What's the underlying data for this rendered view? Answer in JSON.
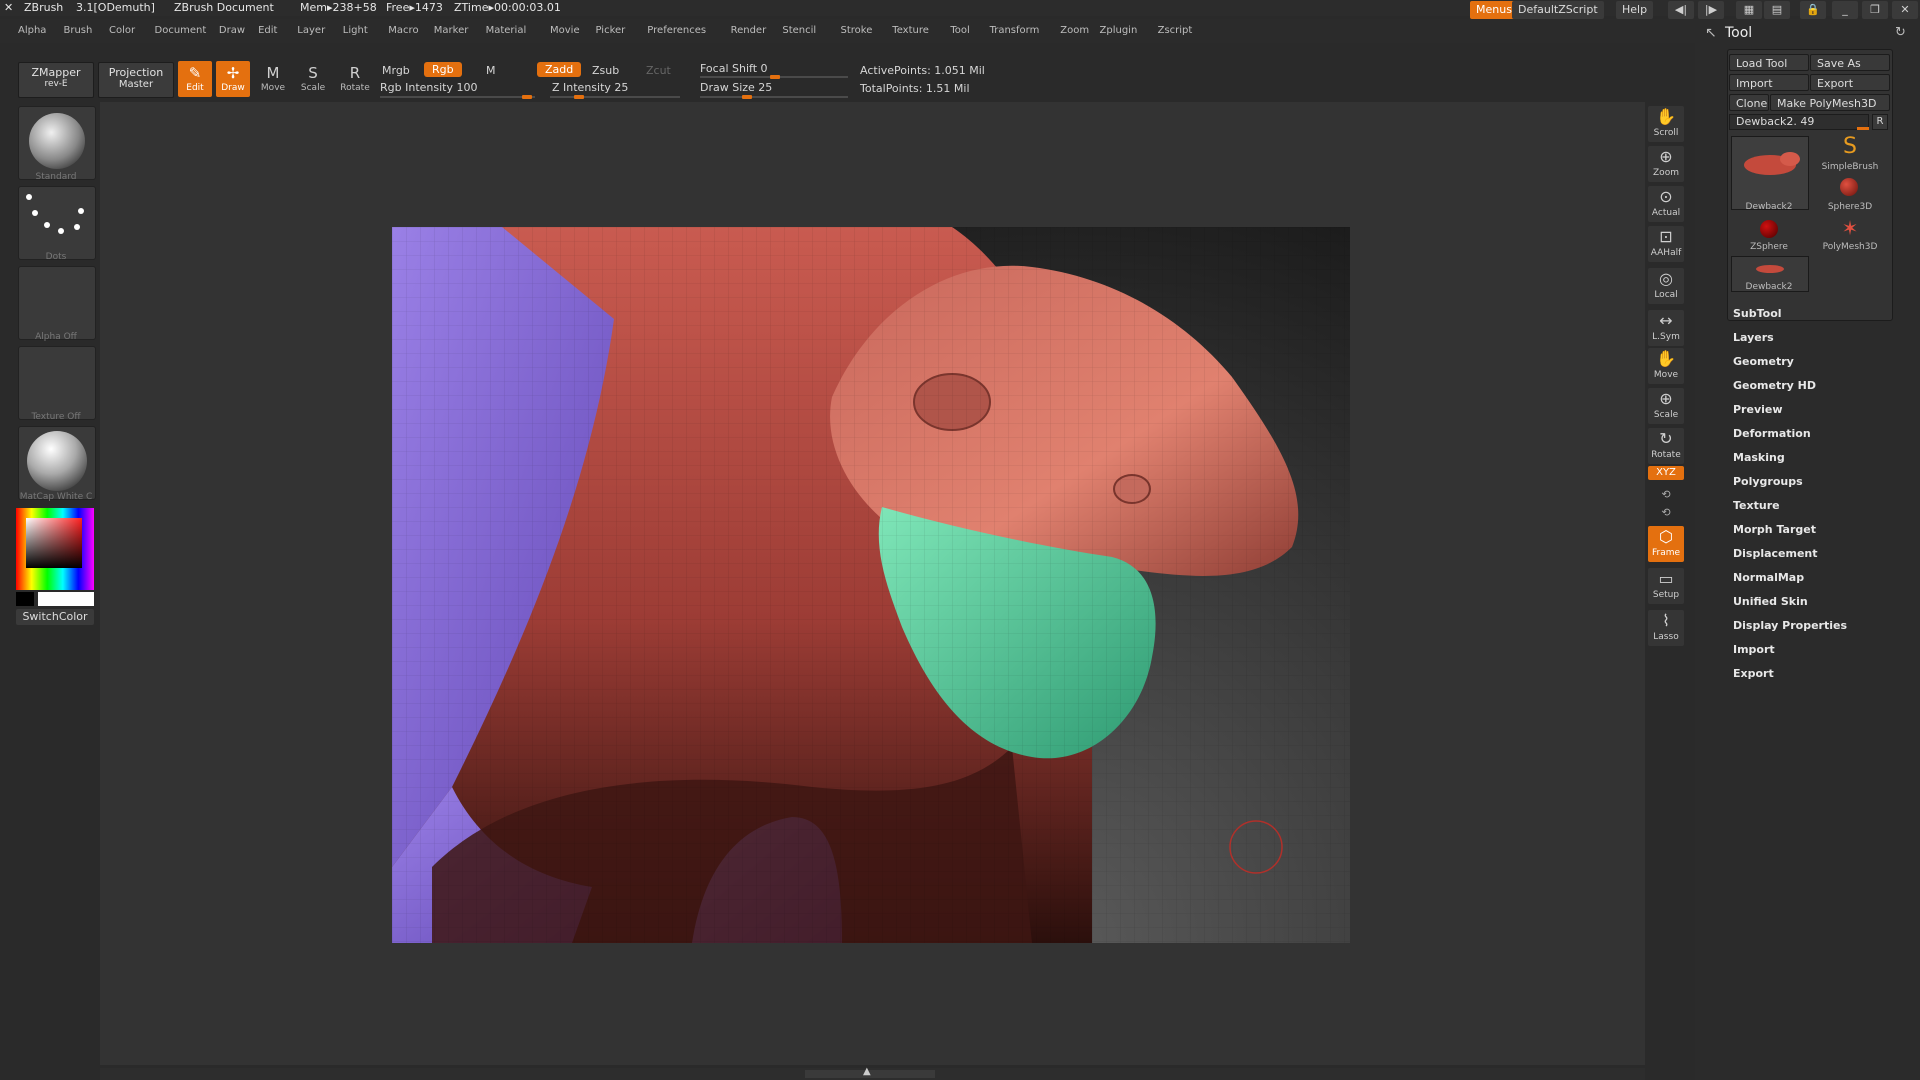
{
  "title": {
    "app": "ZBrush",
    "version": "3.1[ODemuth]",
    "document": "ZBrush Document",
    "mem": "Mem▸238+58",
    "free": "Free▸1473",
    "ztime": "ZTime▸00:00:03.01"
  },
  "top_right": {
    "menus": "Menus",
    "script": "DefaultZScript",
    "help": "Help"
  },
  "menubar": [
    "Alpha",
    "Brush",
    "Color",
    "Document",
    "Draw",
    "Edit",
    "Layer",
    "Light",
    "Macro",
    "Marker",
    "Material",
    "Movie",
    "Picker",
    "Preferences",
    "Render",
    "Stencil",
    "Stroke",
    "Texture",
    "Tool",
    "Transform",
    "Zoom",
    "Zplugin",
    "Zscript"
  ],
  "toolbar": {
    "zmapper": "ZMapper",
    "zmapper_sub": "rev-E",
    "projection": "Projection",
    "projection_sub": "Master",
    "edit": "Edit",
    "draw": "Draw",
    "move": "Move",
    "scale": "Scale",
    "rotate": "Rotate",
    "mrgb": "Mrgb",
    "rgb": "Rgb",
    "m": "M",
    "rgb_intensity": "Rgb Intensity 100",
    "zadd": "Zadd",
    "zsub": "Zsub",
    "zcut": "Zcut",
    "z_intensity": "Z Intensity 25",
    "focal_shift": "Focal Shift 0",
    "draw_size": "Draw Size 25",
    "active_points": "ActivePoints: 1.051  Mil",
    "total_points": "TotalPoints: 1.51  Mil"
  },
  "left_shelf": {
    "brush": "Standard",
    "stroke": "Dots",
    "alpha": "Alpha  Off",
    "texture": "Texture  Off",
    "material": "MatCap  White  C",
    "switch_color": "SwitchColor"
  },
  "right_shelf": [
    "Scroll",
    "Zoom",
    "Actual",
    "AAHalf",
    "Local",
    "L.Sym",
    "Move",
    "Scale",
    "Rotate",
    "Frame",
    "Setup",
    "Lasso"
  ],
  "right_shelf_xyz": "XYZ",
  "tool_palette": {
    "title": "Tool",
    "load_tool": "Load Tool",
    "save_as": "Save As",
    "import": "Import",
    "export": "Export",
    "clone": "Clone",
    "make_polymesh": "Make PolyMesh3D",
    "current": "Dewback2. 49",
    "r": "R",
    "thumbs": [
      "Dewback2",
      "SimpleBrush",
      "Sphere3D",
      "ZSphere",
      "PolyMesh3D",
      "Dewback2"
    ],
    "sections": [
      "SubTool",
      "Layers",
      "Geometry",
      "Geometry HD",
      "Preview",
      "Deformation",
      "Masking",
      "Polygroups",
      "Texture",
      "Morph Target",
      "Displacement",
      "NormalMap",
      "Unified Skin",
      "Display Properties",
      "Import",
      "Export"
    ]
  },
  "colors": {
    "accent": "#e4700f",
    "model_red": "#c95b50",
    "model_purple": "#8a6ed1",
    "model_green": "#5fd4a2"
  }
}
